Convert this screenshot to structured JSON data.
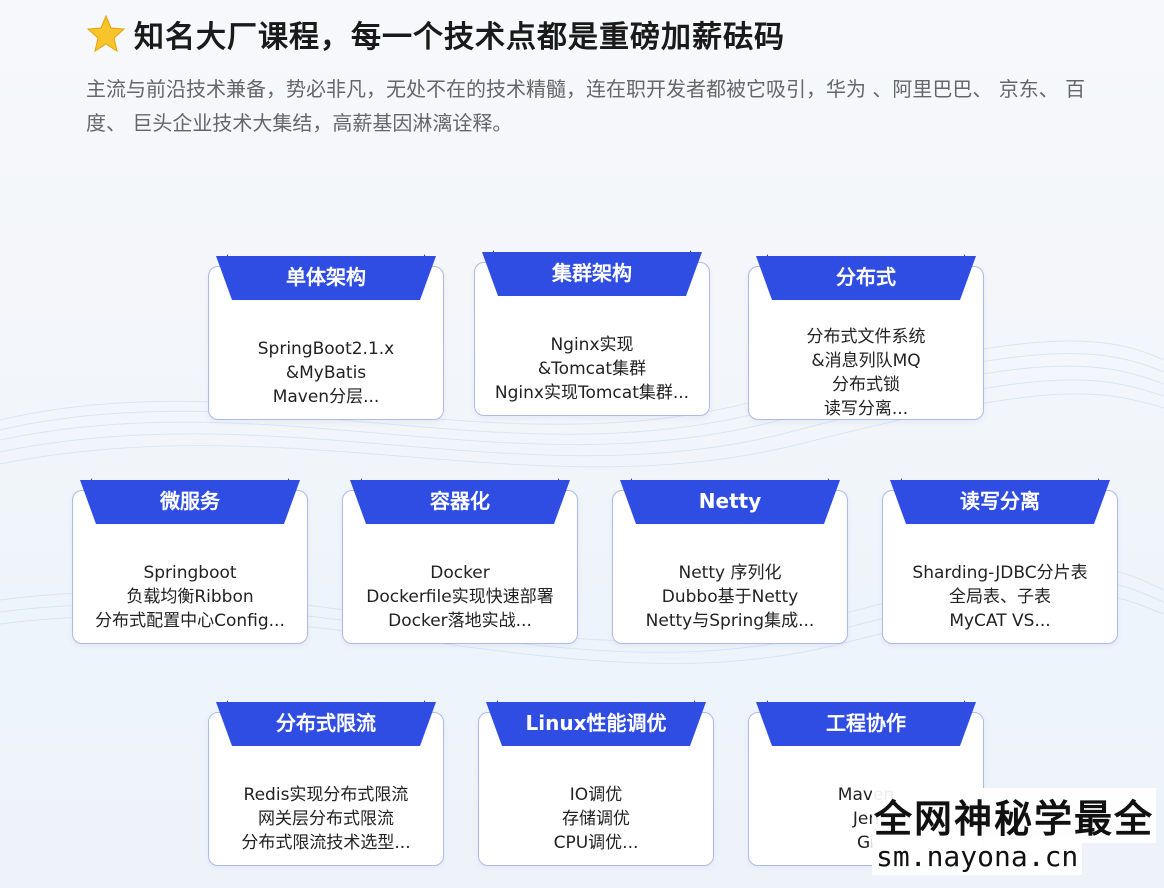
{
  "header": {
    "title": "知名大厂课程，每一个技术点都是重磅加薪砝码",
    "subtitle": "主流与前沿技术兼备，势必非凡，无处不在的技术精髓，连在职开发者都被它吸引，华为 、阿里巴巴、 京东、 百度、 巨头企业技术大集结，高薪基因淋漓诠释。",
    "icon": "star-icon"
  },
  "colors": {
    "tab_blue": "#2f4de3",
    "tab_dark": "#1a2fa8",
    "card_border": "#aebbe8"
  },
  "cards": [
    {
      "title": "单体架构",
      "lines": [
        "SpringBoot2.1.x",
        "&MyBatis",
        "Maven分层..."
      ]
    },
    {
      "title": "集群架构",
      "lines": [
        "Nginx实现",
        "&Tomcat集群",
        "Nginx实现Tomcat集群..."
      ]
    },
    {
      "title": "分布式",
      "lines": [
        "分布式文件系统",
        "&消息列队MQ",
        "分布式锁",
        "读写分离..."
      ]
    },
    {
      "title": "微服务",
      "lines": [
        "Springboot",
        "负载均衡Ribbon",
        "分布式配置中心Config..."
      ]
    },
    {
      "title": "容器化",
      "lines": [
        "Docker",
        "Dockerfile实现快速部署",
        "Docker落地实战..."
      ]
    },
    {
      "title": "Netty",
      "lines": [
        "Netty 序列化",
        "Dubbo基于Netty",
        "Netty与Spring集成..."
      ]
    },
    {
      "title": "读写分离",
      "lines": [
        "Sharding-JDBC分片表",
        "全局表、子表",
        "MyCAT VS..."
      ]
    },
    {
      "title": "分布式限流",
      "lines": [
        "Redis实现分布式限流",
        "网关层分布式限流",
        "分布式限流技术选型..."
      ]
    },
    {
      "title": "Linux性能调优",
      "lines": [
        "IO调优",
        "存储调优",
        "CPU调优..."
      ]
    },
    {
      "title": "工程协作",
      "lines": [
        "Maven",
        "Jen",
        "Gi"
      ]
    }
  ],
  "watermark": {
    "line1": "全网神秘学最全",
    "line2": "sm.nayona.cn"
  }
}
